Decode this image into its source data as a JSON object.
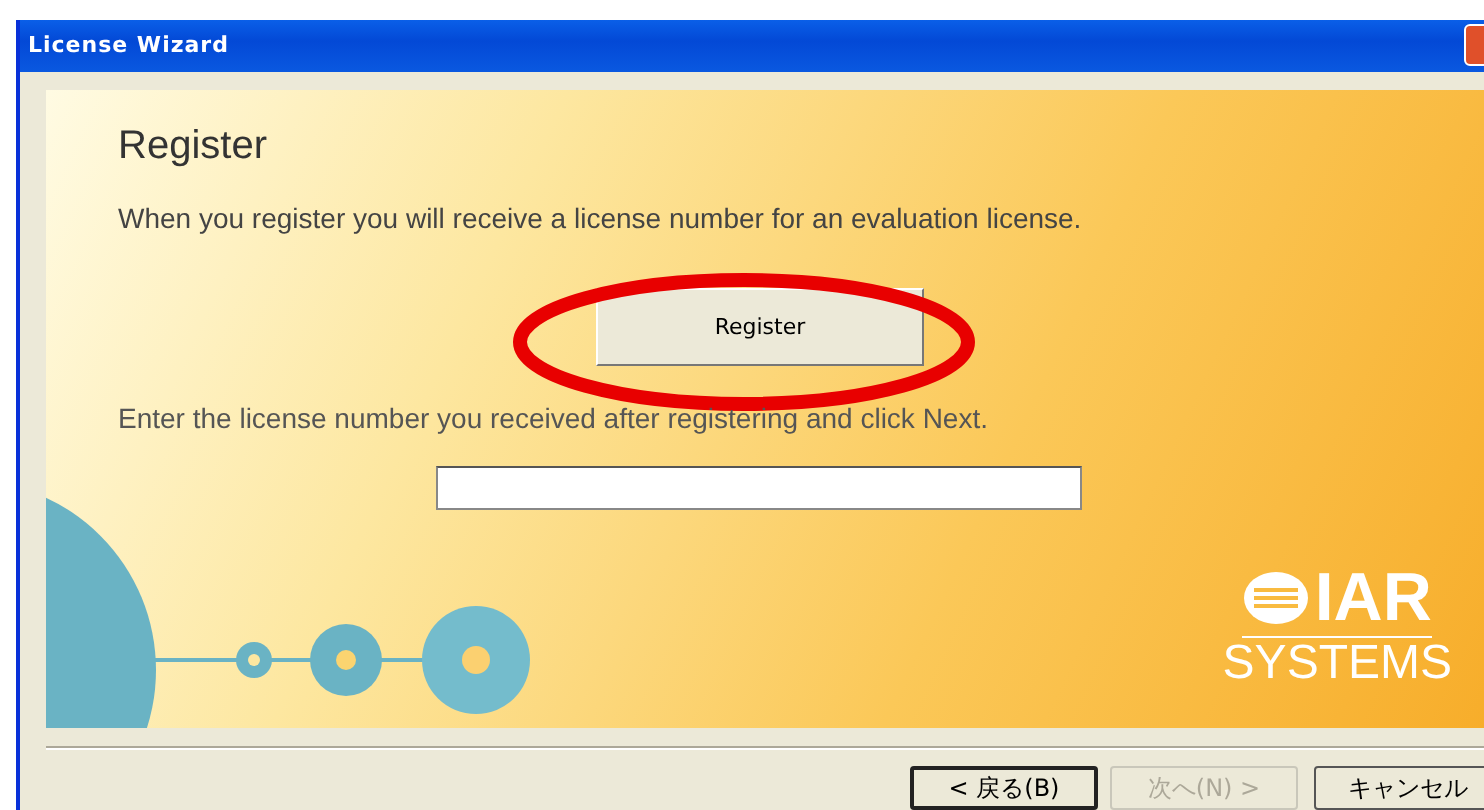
{
  "window": {
    "title": "License Wizard"
  },
  "page": {
    "heading": "Register",
    "description": "When you register you will receive a license number for an evaluation license.",
    "register_button": "Register",
    "instruction": "Enter the license number you received after registering and click Next."
  },
  "logo": {
    "mark": "IAR",
    "subtitle": "SYSTEMS"
  },
  "buttons": [
    {
      "label": "< 戻る(B)",
      "disabled": false,
      "default": true
    },
    {
      "label": "次へ(N) >",
      "disabled": true,
      "default": false
    },
    {
      "label": "キャンセル",
      "disabled": false,
      "default": false
    }
  ]
}
